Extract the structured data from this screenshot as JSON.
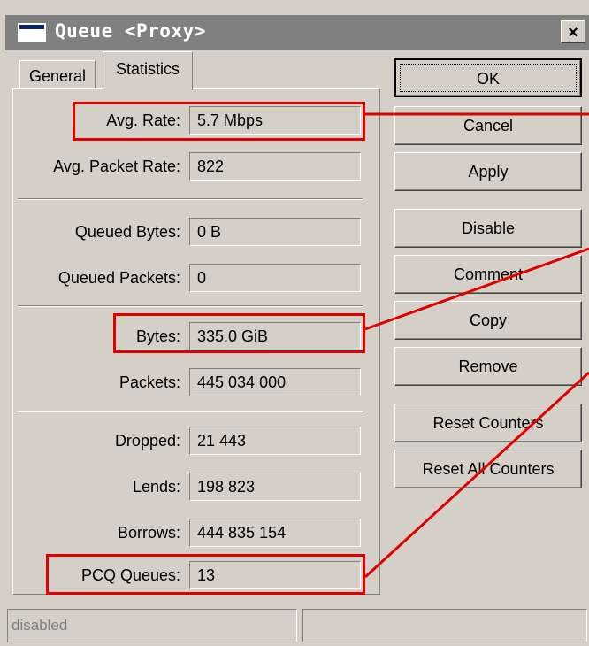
{
  "window": {
    "title": "Queue <Proxy>",
    "close_glyph": "×"
  },
  "tabs": [
    {
      "label": "General",
      "active": false
    },
    {
      "label": "Statistics",
      "active": true
    }
  ],
  "stats": [
    {
      "label": "Avg. Rate:",
      "value": "5.7 Mbps",
      "highlighted": true
    },
    {
      "label": "Avg. Packet Rate:",
      "value": "822",
      "highlighted": false
    },
    {
      "label": "Queued Bytes:",
      "value": "0 B",
      "highlighted": false
    },
    {
      "label": "Queued Packets:",
      "value": "0",
      "highlighted": false
    },
    {
      "label": "Bytes:",
      "value": "335.0 GiB",
      "highlighted": true
    },
    {
      "label": "Packets:",
      "value": "445 034 000",
      "highlighted": false
    },
    {
      "label": "Dropped:",
      "value": "21 443",
      "highlighted": false
    },
    {
      "label": "Lends:",
      "value": "198 823",
      "highlighted": false
    },
    {
      "label": "Borrows:",
      "value": "444 835 154",
      "highlighted": false
    },
    {
      "label": "PCQ Queues:",
      "value": "13",
      "highlighted": true
    }
  ],
  "buttons": [
    {
      "label": "OK",
      "default": true
    },
    {
      "label": "Cancel"
    },
    {
      "label": "Apply"
    },
    {
      "label": "Disable"
    },
    {
      "label": "Comment"
    },
    {
      "label": "Copy"
    },
    {
      "label": "Remove"
    },
    {
      "label": "Reset Counters"
    },
    {
      "label": "Reset All Counters"
    }
  ],
  "status_bar": {
    "left": "disabled",
    "right": ""
  },
  "colors": {
    "window_bg": "#d4d0c8",
    "title_bg": "#808080",
    "annotation_red": "#e00000"
  },
  "icons": {
    "title_icon": "window-icon",
    "close": "close-icon"
  }
}
